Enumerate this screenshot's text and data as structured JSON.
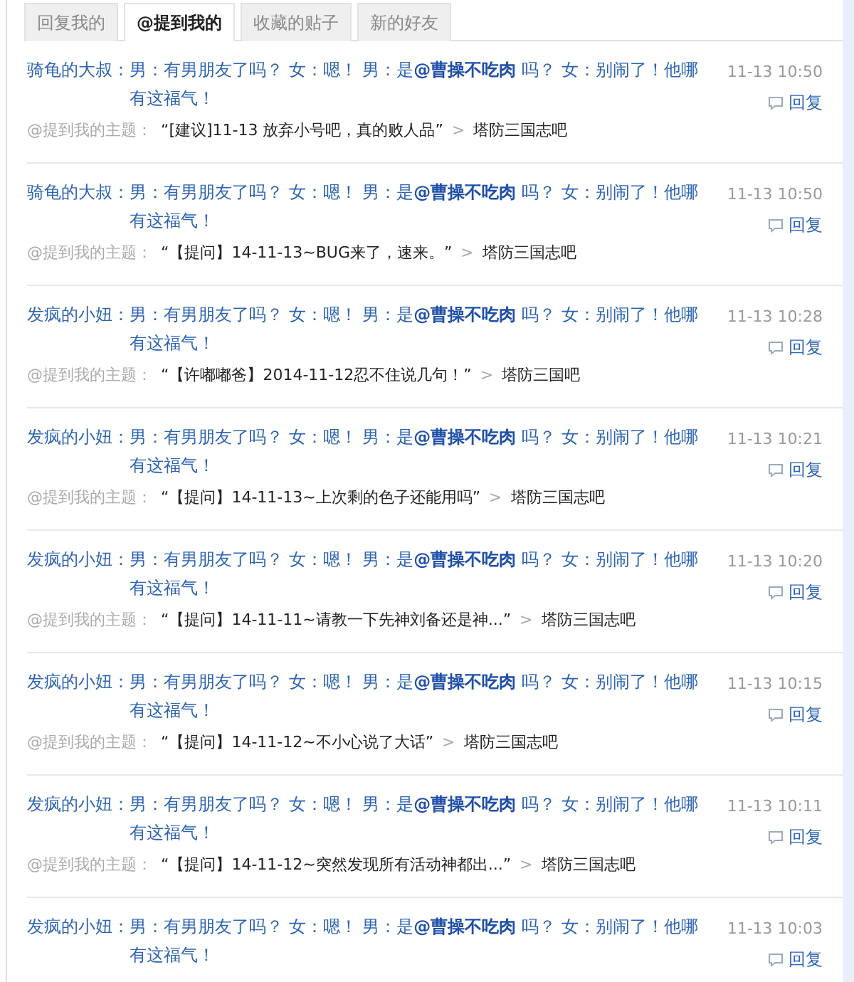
{
  "tabs": [
    {
      "label": "回复我的",
      "selected": false
    },
    {
      "label": "@提到我的",
      "selected": true
    },
    {
      "label": "收藏的贴子",
      "selected": false
    },
    {
      "label": "新的好友",
      "selected": false
    }
  ],
  "items": [
    {
      "user": "骑龟的大叔：",
      "message": "男：有男朋友了吗？ 女：嗯！ 男：是**@曹操不吃肉** 吗？ 女：别闹了！他哪有这福气！",
      "time": "11-13 10:50",
      "reply": "回复",
      "topic_label": "@提到我的主题：",
      "topic": "“[建议]11-13 放弃小号吧，真的败人品”",
      "arrow": ">",
      "forum": "塔防三国志吧"
    },
    {
      "user": "骑龟的大叔：",
      "message": "男：有男朋友了吗？ 女：嗯！ 男：是**@曹操不吃肉** 吗？ 女：别闹了！他哪有这福气！",
      "time": "11-13 10:50",
      "reply": "回复",
      "topic_label": "@提到我的主题：",
      "topic": "“【提问】14-11-13~BUG来了，速来。”",
      "arrow": ">",
      "forum": "塔防三国志吧"
    },
    {
      "user": "发疯的小妞：",
      "message": "男：有男朋友了吗？ 女：嗯！ 男：是**@曹操不吃肉** 吗？ 女：别闹了！他哪有这福气！",
      "time": "11-13 10:28",
      "reply": "回复",
      "topic_label": "@提到我的主题：",
      "topic": "“【许嘟嘟爸】2014-11-12忍不住说几句！”",
      "arrow": ">",
      "forum": "塔防三国吧"
    },
    {
      "user": "发疯的小妞：",
      "message": "男：有男朋友了吗？ 女：嗯！ 男：是**@曹操不吃肉** 吗？ 女：别闹了！他哪有这福气！",
      "time": "11-13 10:21",
      "reply": "回复",
      "topic_label": "@提到我的主题：",
      "topic": "“【提问】14-11-13~上次剩的色子还能用吗”",
      "arrow": ">",
      "forum": "塔防三国志吧"
    },
    {
      "user": "发疯的小妞：",
      "message": "男：有男朋友了吗？ 女：嗯！ 男：是**@曹操不吃肉** 吗？ 女：别闹了！他哪有这福气！",
      "time": "11-13 10:20",
      "reply": "回复",
      "topic_label": "@提到我的主题：",
      "topic": "“【提问】14-11-11~请教一下先神刘备还是神...”",
      "arrow": ">",
      "forum": "塔防三国志吧"
    },
    {
      "user": "发疯的小妞：",
      "message": "男：有男朋友了吗？ 女：嗯！ 男：是**@曹操不吃肉** 吗？ 女：别闹了！他哪有这福气！",
      "time": "11-13 10:15",
      "reply": "回复",
      "topic_label": "@提到我的主题：",
      "topic": "“【提问】14-11-12~不小心说了大话”",
      "arrow": ">",
      "forum": "塔防三国志吧"
    },
    {
      "user": "发疯的小妞：",
      "message": "男：有男朋友了吗？ 女：嗯！ 男：是**@曹操不吃肉** 吗？ 女：别闹了！他哪有这福气！",
      "time": "11-13 10:11",
      "reply": "回复",
      "topic_label": "@提到我的主题：",
      "topic": "“【提问】14-11-12~突然发现所有活动神都出...”",
      "arrow": ">",
      "forum": "塔防三国志吧"
    },
    {
      "user": "发疯的小妞：",
      "message": "男：有男朋友了吗？ 女：嗯！ 男：是**@曹操不吃肉** 吗？ 女：别闹了！他哪有这福气！",
      "time": "11-13 10:03",
      "reply": "回复"
    }
  ]
}
